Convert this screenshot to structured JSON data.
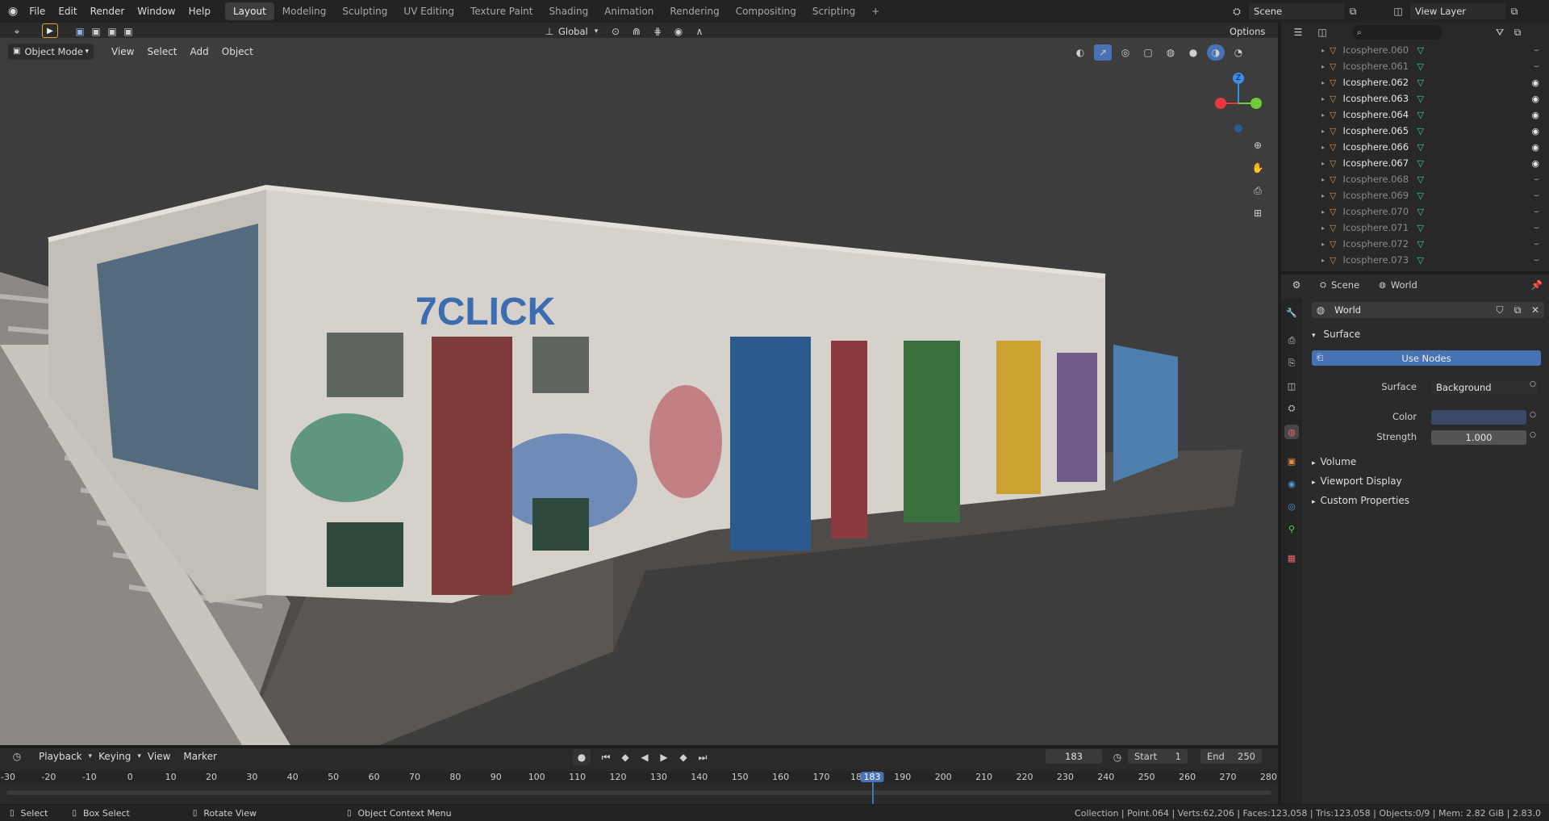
{
  "topbar": {
    "menus": [
      "File",
      "Edit",
      "Render",
      "Window",
      "Help"
    ],
    "workspaces": [
      "Layout",
      "Modeling",
      "Sculpting",
      "UV Editing",
      "Texture Paint",
      "Shading",
      "Animation",
      "Rendering",
      "Compositing",
      "Scripting"
    ],
    "active_workspace": "Layout",
    "add_tab": "+",
    "scene": "Scene",
    "view_layer": "View Layer"
  },
  "header": {
    "transform_orientation": "Global",
    "options": "Options"
  },
  "viewport_header": {
    "mode": "Object Mode",
    "menus": [
      "View",
      "Select",
      "Add",
      "Object"
    ]
  },
  "outliner": {
    "search_placeholder": "",
    "items": [
      {
        "name": "Icosphere.060",
        "visible": false
      },
      {
        "name": "Icosphere.061",
        "visible": false
      },
      {
        "name": "Icosphere.062",
        "visible": true
      },
      {
        "name": "Icosphere.063",
        "visible": true
      },
      {
        "name": "Icosphere.064",
        "visible": true
      },
      {
        "name": "Icosphere.065",
        "visible": true
      },
      {
        "name": "Icosphere.066",
        "visible": true
      },
      {
        "name": "Icosphere.067",
        "visible": true
      },
      {
        "name": "Icosphere.068",
        "visible": false
      },
      {
        "name": "Icosphere.069",
        "visible": false
      },
      {
        "name": "Icosphere.070",
        "visible": false
      },
      {
        "name": "Icosphere.071",
        "visible": false
      },
      {
        "name": "Icosphere.072",
        "visible": false
      },
      {
        "name": "Icosphere.073",
        "visible": false
      }
    ]
  },
  "properties": {
    "breadcrumb_scene": "Scene",
    "breadcrumb_world": "World",
    "world_name": "World",
    "surface_panel": "Surface",
    "use_nodes": "Use Nodes",
    "surface_label": "Surface",
    "surface_value": "Background",
    "color_label": "Color",
    "color_value": "#3a4a66",
    "strength_label": "Strength",
    "strength_value": "1.000",
    "collapsed_panels": [
      "Volume",
      "Viewport Display",
      "Custom Properties"
    ]
  },
  "timeline": {
    "menus": [
      "Playback",
      "Keying",
      "View",
      "Marker"
    ],
    "current_frame": "183",
    "start_label": "Start",
    "start_value": "1",
    "end_label": "End",
    "end_value": "250",
    "ticks": [
      "-30",
      "-20",
      "-10",
      "0",
      "10",
      "20",
      "30",
      "40",
      "50",
      "60",
      "70",
      "80",
      "90",
      "100",
      "110",
      "120",
      "130",
      "140",
      "150",
      "160",
      "170",
      "18",
      "183",
      "190",
      "200",
      "210",
      "220",
      "230",
      "240",
      "250",
      "260",
      "270",
      "280"
    ]
  },
  "statusbar": {
    "select": "Select",
    "box_select": "Box Select",
    "rotate_view": "Rotate View",
    "context_menu": "Object Context Menu",
    "stats": "Collection | Point.064 | Verts:62,206 | Faces:123,058 | Tris:123,058 | Objects:0/9 | Mem: 2.82 GiB | 2.83.0"
  },
  "gizmo": {
    "z_label": "Z",
    "colors": {
      "x": "#e8383d",
      "y": "#6ecb3c",
      "z": "#3a8de8"
    }
  },
  "colors": {
    "accent": "#4772b3",
    "viewport_bg": "#3d3d3d"
  }
}
